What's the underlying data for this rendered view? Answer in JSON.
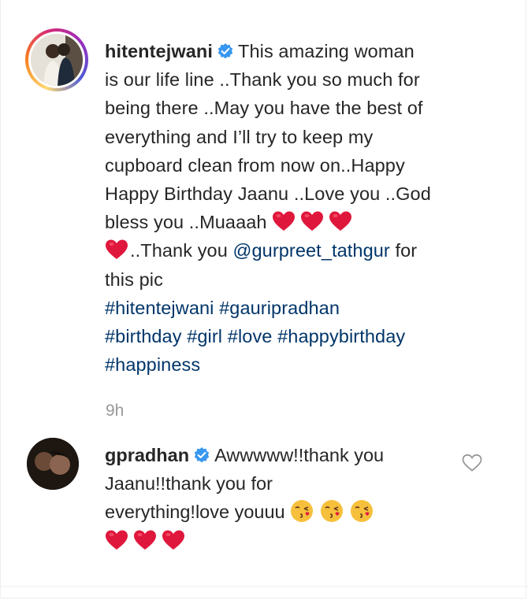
{
  "post": {
    "username": "hitentejwani",
    "caption_lines": [
      "This amazing woman",
      "is our life line ..Thank you so much for",
      "being there ..May you have the best of",
      "everything and I’ll try to keep my",
      "cupboard clean from now on..Happy",
      "Happy Birthday Jaanu ..Love you ..God",
      "bless you ..Muaaah"
    ],
    "thanks_text": "..Thank you",
    "mention": "@gurpreet_tathgur",
    "after_mention": "for",
    "this_pic": "this pic",
    "hashtags": [
      "#hitentejwani",
      "#gauripradhan",
      "#birthday",
      "#girl",
      "#love",
      "#happybirthday",
      "#happiness"
    ],
    "timestamp": "9h"
  },
  "reply": {
    "username": "gpradhan",
    "text_lines": [
      "Awwwww!!thank you",
      "Jaanu!!thank you for",
      "everything!love youuu"
    ]
  },
  "icons": {
    "verified": "verified-badge-icon",
    "heart": "red-heart-emoji",
    "kiss": "face-blowing-kiss-emoji",
    "like": "heart-outline-icon"
  },
  "colors": {
    "link": "#003569",
    "verified": "#3897f0",
    "heart": "#e0173c",
    "muted": "#999999"
  }
}
